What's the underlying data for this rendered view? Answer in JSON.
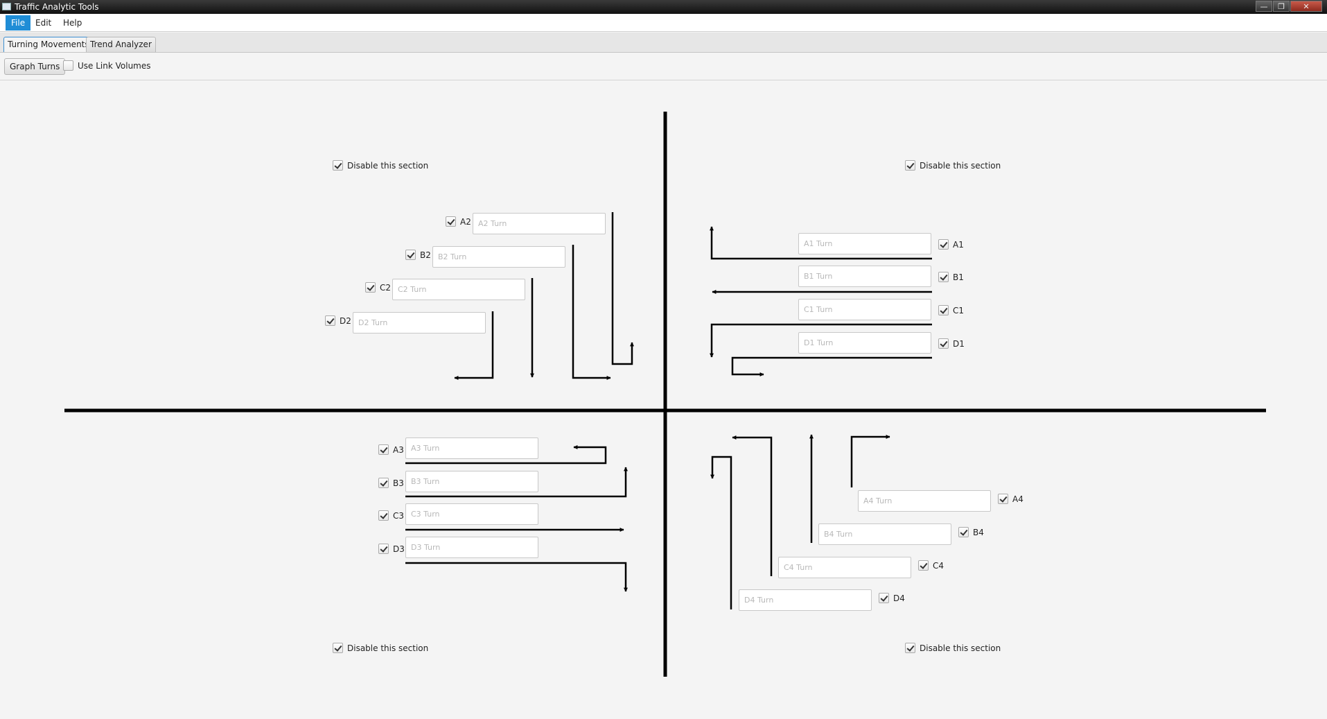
{
  "window": {
    "title": "Traffic Analytic Tools"
  },
  "menu": {
    "items": [
      "File",
      "Edit",
      "Help"
    ],
    "active": "File"
  },
  "tabs": [
    {
      "label": "Turning Movements",
      "selected": true
    },
    {
      "label": "Trend Analyzer",
      "selected": false
    }
  ],
  "toolbar": {
    "graph_turns_label": "Graph Turns",
    "use_link_volumes": {
      "label": "Use Link Volumes",
      "checked": false
    }
  },
  "sections": {
    "top_left": {
      "disable_label": "Disable this section",
      "checked": true
    },
    "top_right": {
      "disable_label": "Disable this section",
      "checked": true
    },
    "bottom_left": {
      "disable_label": "Disable this section",
      "checked": true
    },
    "bottom_right": {
      "disable_label": "Disable this section",
      "checked": true
    }
  },
  "turns": {
    "A1": {
      "label": "A1",
      "placeholder": "A1 Turn",
      "checked": true
    },
    "B1": {
      "label": "B1",
      "placeholder": "B1 Turn",
      "checked": true
    },
    "C1": {
      "label": "C1",
      "placeholder": "C1 Turn",
      "checked": true
    },
    "D1": {
      "label": "D1",
      "placeholder": "D1 Turn",
      "checked": true
    },
    "A2": {
      "label": "A2",
      "placeholder": "A2 Turn",
      "checked": true
    },
    "B2": {
      "label": "B2",
      "placeholder": "B2 Turn",
      "checked": true
    },
    "C2": {
      "label": "C2",
      "placeholder": "C2 Turn",
      "checked": true
    },
    "D2": {
      "label": "D2",
      "placeholder": "D2 Turn",
      "checked": true
    },
    "A3": {
      "label": "A3",
      "placeholder": "A3 Turn",
      "checked": true
    },
    "B3": {
      "label": "B3",
      "placeholder": "B3 Turn",
      "checked": true
    },
    "C3": {
      "label": "C3",
      "placeholder": "C3 Turn",
      "checked": true
    },
    "D3": {
      "label": "D3",
      "placeholder": "D3 Turn",
      "checked": true
    },
    "A4": {
      "label": "A4",
      "placeholder": "A4 Turn",
      "checked": true
    },
    "B4": {
      "label": "B4",
      "placeholder": "B4 Turn",
      "checked": true
    },
    "C4": {
      "label": "C4",
      "placeholder": "C4 Turn",
      "checked": true
    },
    "D4": {
      "label": "D4",
      "placeholder": "D4 Turn",
      "checked": true
    }
  },
  "colors": {
    "accent": "#1f8dd6",
    "lines": "#000000"
  }
}
